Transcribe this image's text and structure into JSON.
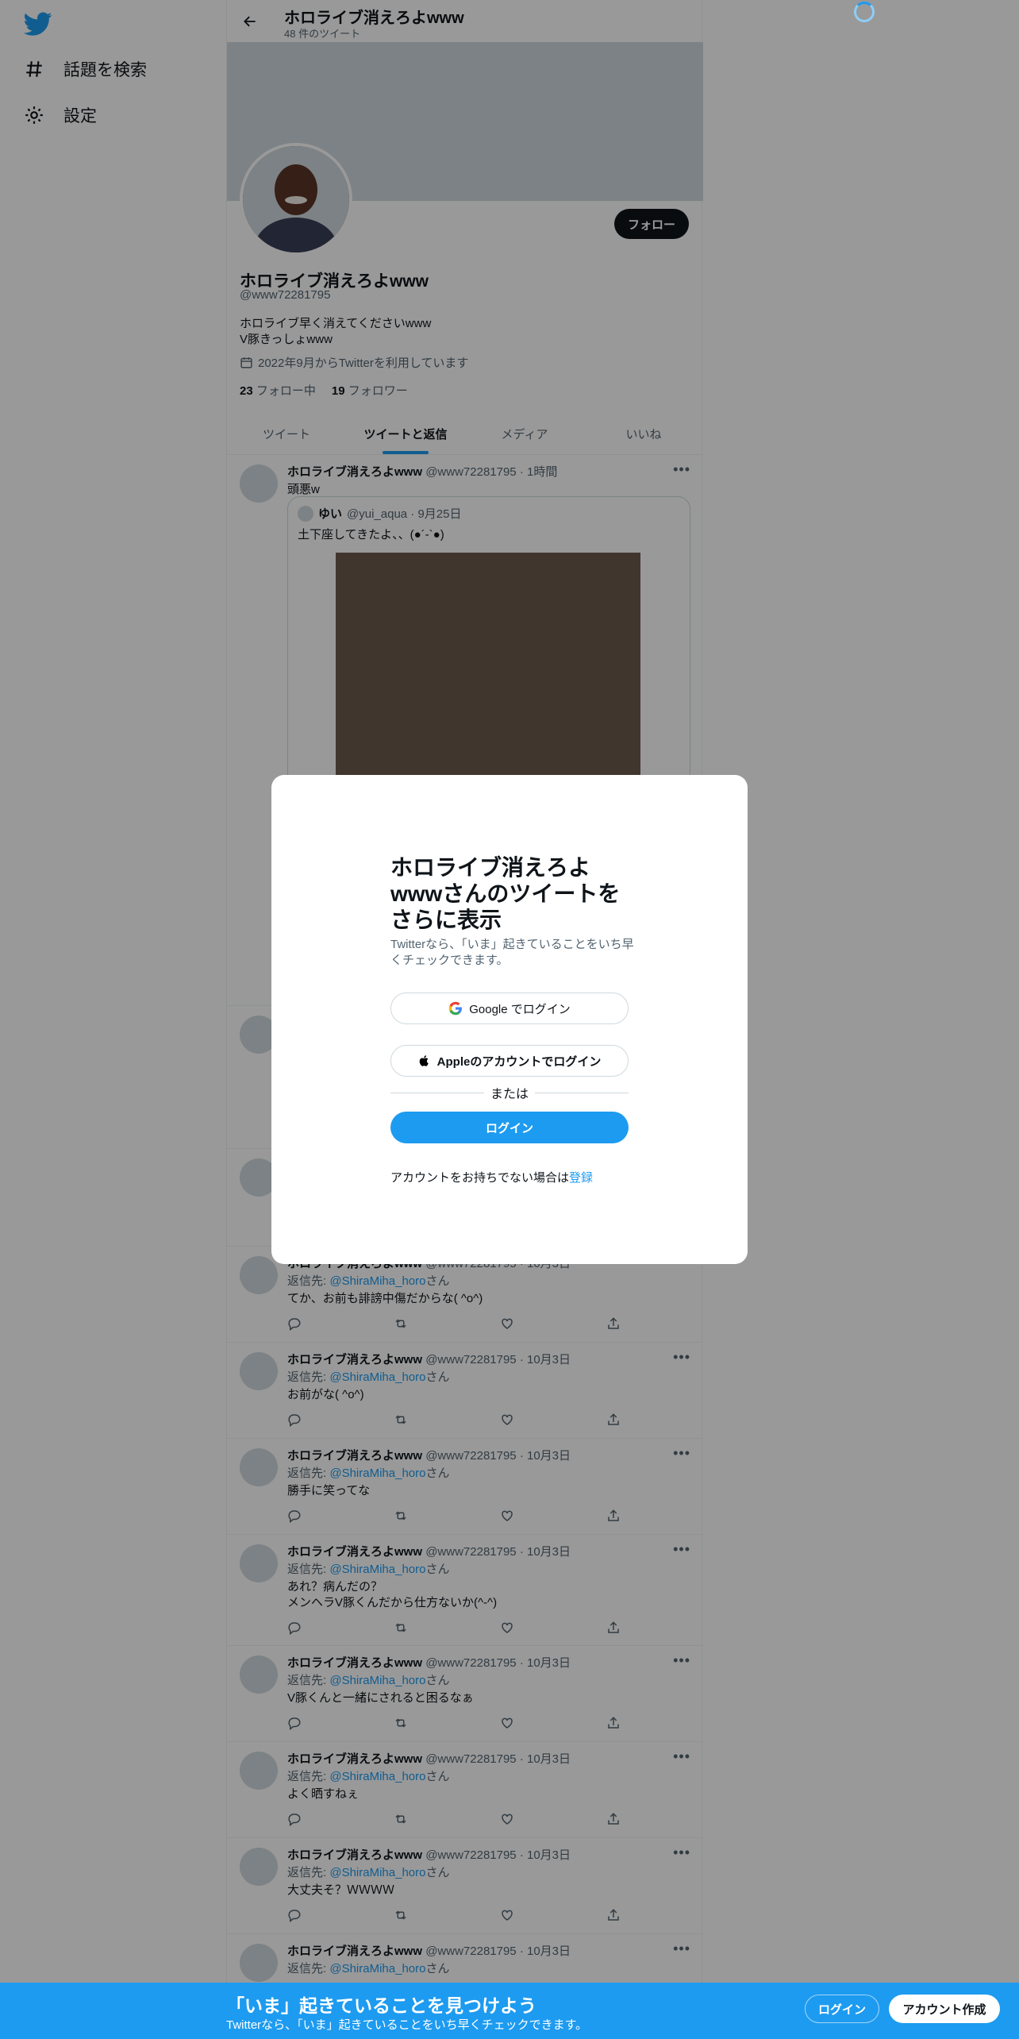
{
  "nav": {
    "explore_label": "話題を検索",
    "settings_label": "設定"
  },
  "header": {
    "title": "ホロライブ消えろよwww",
    "tweet_count": "48 件のツイート"
  },
  "profile": {
    "follow_label": "フォロー",
    "name": "ホロライブ消えろよwww",
    "handle": "@www72281795",
    "bio_lines": [
      "ホロライブ早く消えてくださいwww",
      "V豚きっしょwww"
    ],
    "joined": "2022年9月からTwitterを利用しています",
    "following_count": "23",
    "following_label": "フォロー中",
    "followers_count": "19",
    "followers_label": "フォロワー"
  },
  "tabs": [
    "ツイート",
    "ツイートと返信",
    "メディア",
    "いいね"
  ],
  "quoted_tweet": {
    "name": "ホロライブ消えろよwww",
    "handle_time": "@www72281795 · 1時間",
    "text": "頭悪w",
    "quote_name": "ゆい",
    "quote_handle_time": "@yui_aqua · 9月25日",
    "quote_text": "土下座してきたよ、、(●︎︎´-︎`●︎︎)"
  },
  "tweets": [
    {
      "name": "ホロライブ消えろよwww",
      "handle_time": "@www72281795 · 10月3日",
      "reply_prefix": "返信先: ",
      "reply_to": "@ShiraMiha_horo",
      "reply_suffix": "さん",
      "lines": [
        "てか、お前も誹謗中傷だからな( ^o^)"
      ]
    },
    {
      "name": "ホロライブ消えろよwww",
      "handle_time": "@www72281795 · 10月3日",
      "reply_prefix": "返信先: ",
      "reply_to": "@ShiraMiha_horo",
      "reply_suffix": "さん",
      "lines": [
        "お前がな( ^o^)"
      ]
    },
    {
      "name": "ホロライブ消えろよwww",
      "handle_time": "@www72281795 · 10月3日",
      "reply_prefix": "返信先: ",
      "reply_to": "@ShiraMiha_horo",
      "reply_suffix": "さん",
      "lines": [
        "勝手に笑ってな"
      ]
    },
    {
      "name": "ホロライブ消えろよwww",
      "handle_time": "@www72281795 · 10月3日",
      "reply_prefix": "返信先: ",
      "reply_to": "@ShiraMiha_horo",
      "reply_suffix": "さん",
      "lines": [
        "あれ？病んだの？",
        "メンヘラV豚くんだから仕方ないか(^-^)"
      ]
    },
    {
      "name": "ホロライブ消えろよwww",
      "handle_time": "@www72281795 · 10月3日",
      "reply_prefix": "返信先: ",
      "reply_to": "@ShiraMiha_horo",
      "reply_suffix": "さん",
      "lines": [
        "V豚くんと一緒にされると困るなぁ"
      ]
    },
    {
      "name": "ホロライブ消えろよwww",
      "handle_time": "@www72281795 · 10月3日",
      "reply_prefix": "返信先: ",
      "reply_to": "@ShiraMiha_horo",
      "reply_suffix": "さん",
      "lines": [
        "よく晒すねぇ"
      ]
    },
    {
      "name": "ホロライブ消えろよwww",
      "handle_time": "@www72281795 · 10月3日",
      "reply_prefix": "返信先: ",
      "reply_to": "@ShiraMiha_horo",
      "reply_suffix": "さん",
      "lines": [
        "大丈夫そ？ＷＷＷＷ"
      ]
    },
    {
      "name": "ホロライブ消えろよwww",
      "handle_time": "@www72281795 · 10月3日",
      "reply_prefix": "返信先: ",
      "reply_to": "@ShiraMiha_horo",
      "reply_suffix": "さん",
      "lines": []
    }
  ],
  "partial_tweet_top": {
    "name": "ホロライブ消えろよwww",
    "handle_time": "@www72281795 · 10月3日"
  },
  "modal": {
    "title": "ホロライブ消えろよwwwさんのツイートをさらに表示",
    "subtitle": "Twitterなら、「いま」起きていることをいち早くチェックできます。",
    "google_label": "Google でログイン",
    "apple_label": "Appleのアカウントでログイン",
    "or_label": "または",
    "login_label": "ログイン",
    "signup_prefix": "アカウントをお持ちでない場合は",
    "signup_link": "登録"
  },
  "bottom_bar": {
    "title": "「いま」起きていることを見つけよう",
    "subtitle": "Twitterなら、「いま」起きていることをいち早くチェックできます。",
    "login_label": "ログイン",
    "signup_label": "アカウント作成"
  },
  "colors": {
    "accent": "#1d9bf0",
    "text": "#0f1419",
    "muted": "#536471",
    "border": "#cfd9de"
  }
}
